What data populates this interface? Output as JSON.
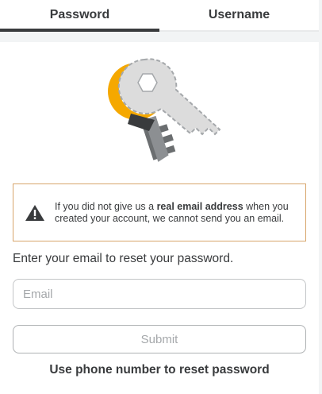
{
  "tabs": [
    {
      "label": "Password",
      "active": true
    },
    {
      "label": "Username",
      "active": false
    }
  ],
  "illustration": {
    "icon": "key-icon"
  },
  "alert": {
    "icon": "warning-icon",
    "text_before": "If you did not give us a ",
    "text_bold": "real email address",
    "text_after": " when you created your account, we cannot send you an email.",
    "border_color": "#d7a56b"
  },
  "instructions": "Enter your email to reset your password.",
  "email": {
    "placeholder": "Email",
    "value": ""
  },
  "submit_label": "Submit",
  "phone_link_label": "Use phone number to reset password"
}
